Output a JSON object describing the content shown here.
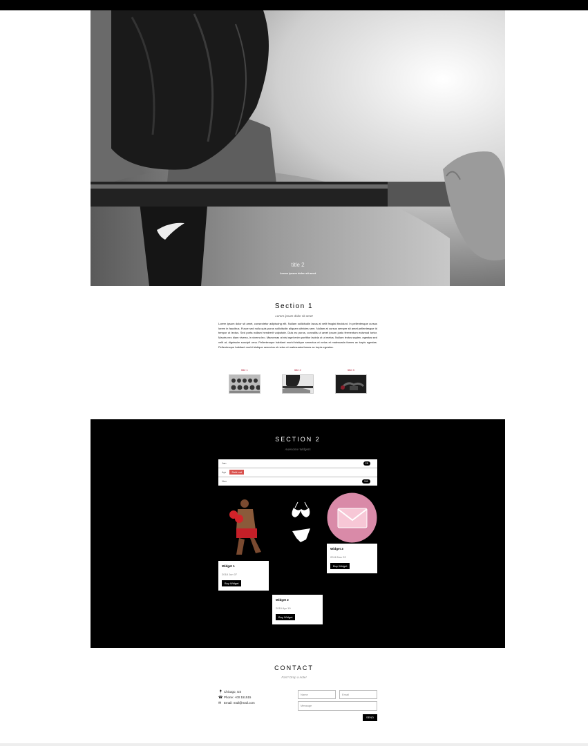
{
  "hero": {
    "title": "title 2",
    "subtitle": "Lorem ipsum dolor sit amet"
  },
  "section1": {
    "title": "Section 1",
    "subtitle": "Lorem ipsum dolor sit amet",
    "body": "Lorem ipsum dolor sit amet, consectetur adipiscing elit. Nullam sollicitudin lacus at velit feugiat tincidunt. In pellentesque cursus lorem in faucibus. Fusce sed nulla quis purus sollicitudin aliquam ultricies sem. Nullam at cursus semper sit amet pellentesque id tempor ut lectus. Sed porta nullam hendrerit vulputate. Duis eu purus, convallis ut amet ipsum justo fermentum euismod tortor. Mauris nec diam viverra, in viverra leo. Maecenas at nisi eget enim porttitor lacinia ut ut metus. Nullam lectus sapien, egestas sed velit at, dignissim suscipit urna. Pellentesque habitant morbi tristique senectus et netus et malesuada fames ac turpis egestas. Pellentesque habitant morbi tristique senectus et netus et malesuada fames ac turpis egestas.",
    "thumbs": [
      {
        "label": "title 1"
      },
      {
        "label": "title 2"
      },
      {
        "label": "title 3"
      }
    ]
  },
  "section2": {
    "title": "SECTION 2",
    "subtitle": "Awesome Widgets",
    "list": [
      {
        "label": "Jan",
        "badge": "25"
      },
      {
        "label": "Apr",
        "tag": "Sold out"
      },
      {
        "label": "Nov",
        "badge": "111"
      }
    ],
    "widgets": [
      {
        "title": "Widget 1",
        "date": "2018 Jun 07",
        "button": "Buy Widget"
      },
      {
        "title": "Widget 2",
        "date": "2019 Apr 19",
        "button": "Buy Widget"
      },
      {
        "title": "Widget 3",
        "date": "2016 Nov 22",
        "button": "Buy Widget"
      }
    ]
  },
  "contact": {
    "title": "CONTACT",
    "subtitle": "Fan? Drop a note!",
    "location": "Chicago, US",
    "phone": "Phone: +00 151515",
    "email": "Email: mail@mail.com",
    "name_placeholder": "Name",
    "email_placeholder": "Email",
    "message_placeholder": "Message",
    "send_label": "SEND"
  }
}
